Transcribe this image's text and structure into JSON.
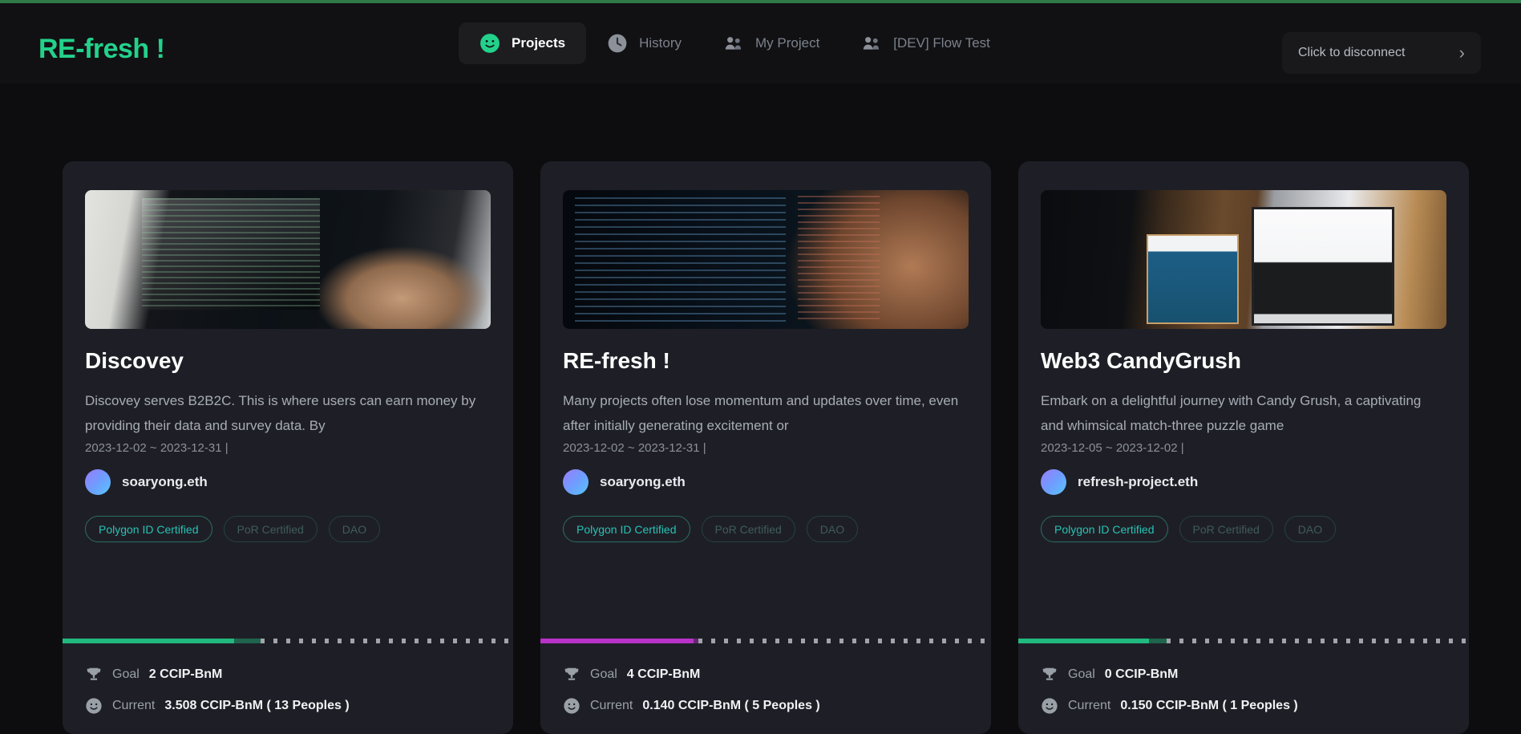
{
  "header": {
    "logo": "RE-fresh !",
    "nav": [
      {
        "label": "Projects",
        "icon": "smiley-icon",
        "active": true
      },
      {
        "label": "History",
        "icon": "clock-icon",
        "active": false
      },
      {
        "label": "My Project",
        "icon": "people-icon",
        "active": false
      },
      {
        "label": "[DEV] Flow Test",
        "icon": "people-icon",
        "active": false
      }
    ],
    "disconnect": {
      "label": "Click to disconnect",
      "chevron": "›"
    }
  },
  "colors": {
    "accent_green": "#23d18b",
    "accent_magenta": "#b832c8",
    "badge_active": "#27c2b5",
    "badge_dim": "#3f5c5a",
    "page_bg": "#0d0d0f",
    "card_bg": "#1e1f26"
  },
  "cards": [
    {
      "title": "Discovey",
      "description": "Discovey serves B2B2C. This is where users can earn money by providing their data and survey data. By",
      "dates": "2023-12-02 ~ 2023-12-31 |",
      "owner": "soaryong.eth",
      "badges": [
        {
          "label": "Polygon ID Certified",
          "active": true
        },
        {
          "label": "PoR Certified",
          "active": false
        },
        {
          "label": "DAO",
          "active": false
        }
      ],
      "progress": {
        "color": "#21b97f",
        "fill_pct": 38,
        "tip_pct": 6
      },
      "goal_label": "Goal",
      "goal_value": "2 CCIP-BnM",
      "current_label": "Current",
      "current_value": "3.508 CCIP-BnM ( 13 Peoples )",
      "image": "photo-hands-typing-code"
    },
    {
      "title": "RE-fresh !",
      "description": "Many projects often lose momentum and updates over time, even after initially generating excitement or",
      "dates": "2023-12-02 ~ 2023-12-31 |",
      "owner": "soaryong.eth",
      "badges": [
        {
          "label": "Polygon ID Certified",
          "active": true
        },
        {
          "label": "PoR Certified",
          "active": false
        },
        {
          "label": "DAO",
          "active": false
        }
      ],
      "progress": {
        "color": "#b832c8",
        "fill_pct": 34,
        "tip_pct": 1
      },
      "goal_label": "Goal",
      "goal_value": "4 CCIP-BnM",
      "current_label": "Current",
      "current_value": "0.140 CCIP-BnM ( 5 Peoples )",
      "image": "photo-code-editor-blurred-person"
    },
    {
      "title": "Web3 CandyGrush",
      "description": "Embark on a delightful journey with Candy Grush, a captivating and whimsical match-three puzzle game",
      "dates": "2023-12-05 ~ 2023-12-02 |",
      "owner": "refresh-project.eth",
      "badges": [
        {
          "label": "Polygon ID Certified",
          "active": true
        },
        {
          "label": "PoR Certified",
          "active": false
        },
        {
          "label": "DAO",
          "active": false
        }
      ],
      "progress": {
        "color": "#21b97f",
        "fill_pct": 29,
        "tip_pct": 4
      },
      "goal_label": "Goal",
      "goal_value": "0 CCIP-BnM",
      "current_label": "Current",
      "current_value": "0.150 CCIP-BnM ( 1 Peoples )",
      "image": "photo-developer-two-monitors"
    }
  ]
}
